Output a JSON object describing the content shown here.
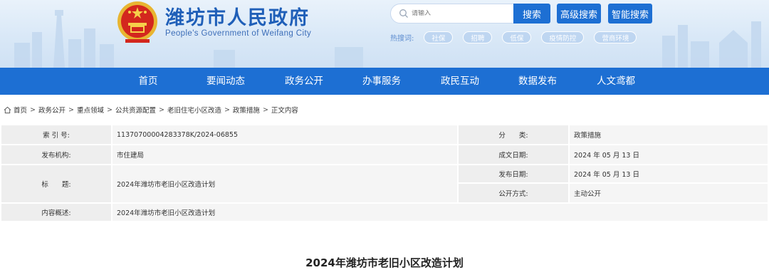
{
  "header": {
    "title": "潍坊市人民政府",
    "subtitle": "People's Government of Weifang City",
    "search": {
      "placeholder": "请输入",
      "button": "搜索",
      "advanced_button": "高级搜索",
      "smart_button": "智能搜索"
    },
    "hot": {
      "label": "热搜词:",
      "tags": [
        "社保",
        "招聘",
        "低保",
        "疫情防控",
        "营商环境"
      ]
    }
  },
  "nav": [
    "首页",
    "要闻动态",
    "政务公开",
    "办事服务",
    "政民互动",
    "数据发布",
    "人文鸢都"
  ],
  "breadcrumb": [
    "首页",
    "政务公开",
    "重点领域",
    "公共资源配置",
    "老旧住宅小区改造",
    "政策措施",
    "正文内容"
  ],
  "info": {
    "index_label": "索 引 号:",
    "index_value": "11370700004283378K/2024-06855",
    "category_label": "分　　类:",
    "category_value": "政策措施",
    "org_label": "发布机构:",
    "org_value": "市住建局",
    "created_label": "成文日期:",
    "created_value": "2024 年 05 月 13 日",
    "title_label": "标　　题:",
    "title_value": "2024年潍坊市老旧小区改造计划",
    "published_label": "发布日期:",
    "published_value": "2024 年 05 月 13 日",
    "mode_label": "公开方式:",
    "mode_value": "主动公开",
    "summary_label": "内容概述:",
    "summary_value": "2024年潍坊市老旧小区改造计划"
  },
  "article": {
    "title": "2024年潍坊市老旧小区改造计划"
  },
  "colors": {
    "primary": "#1d6fd3",
    "brand_text": "#1f5fb8",
    "label_bg": "#eeeeee",
    "value_bg": "#f5f5f5"
  },
  "icons": [
    "national-emblem-icon",
    "search-icon",
    "home-icon"
  ]
}
